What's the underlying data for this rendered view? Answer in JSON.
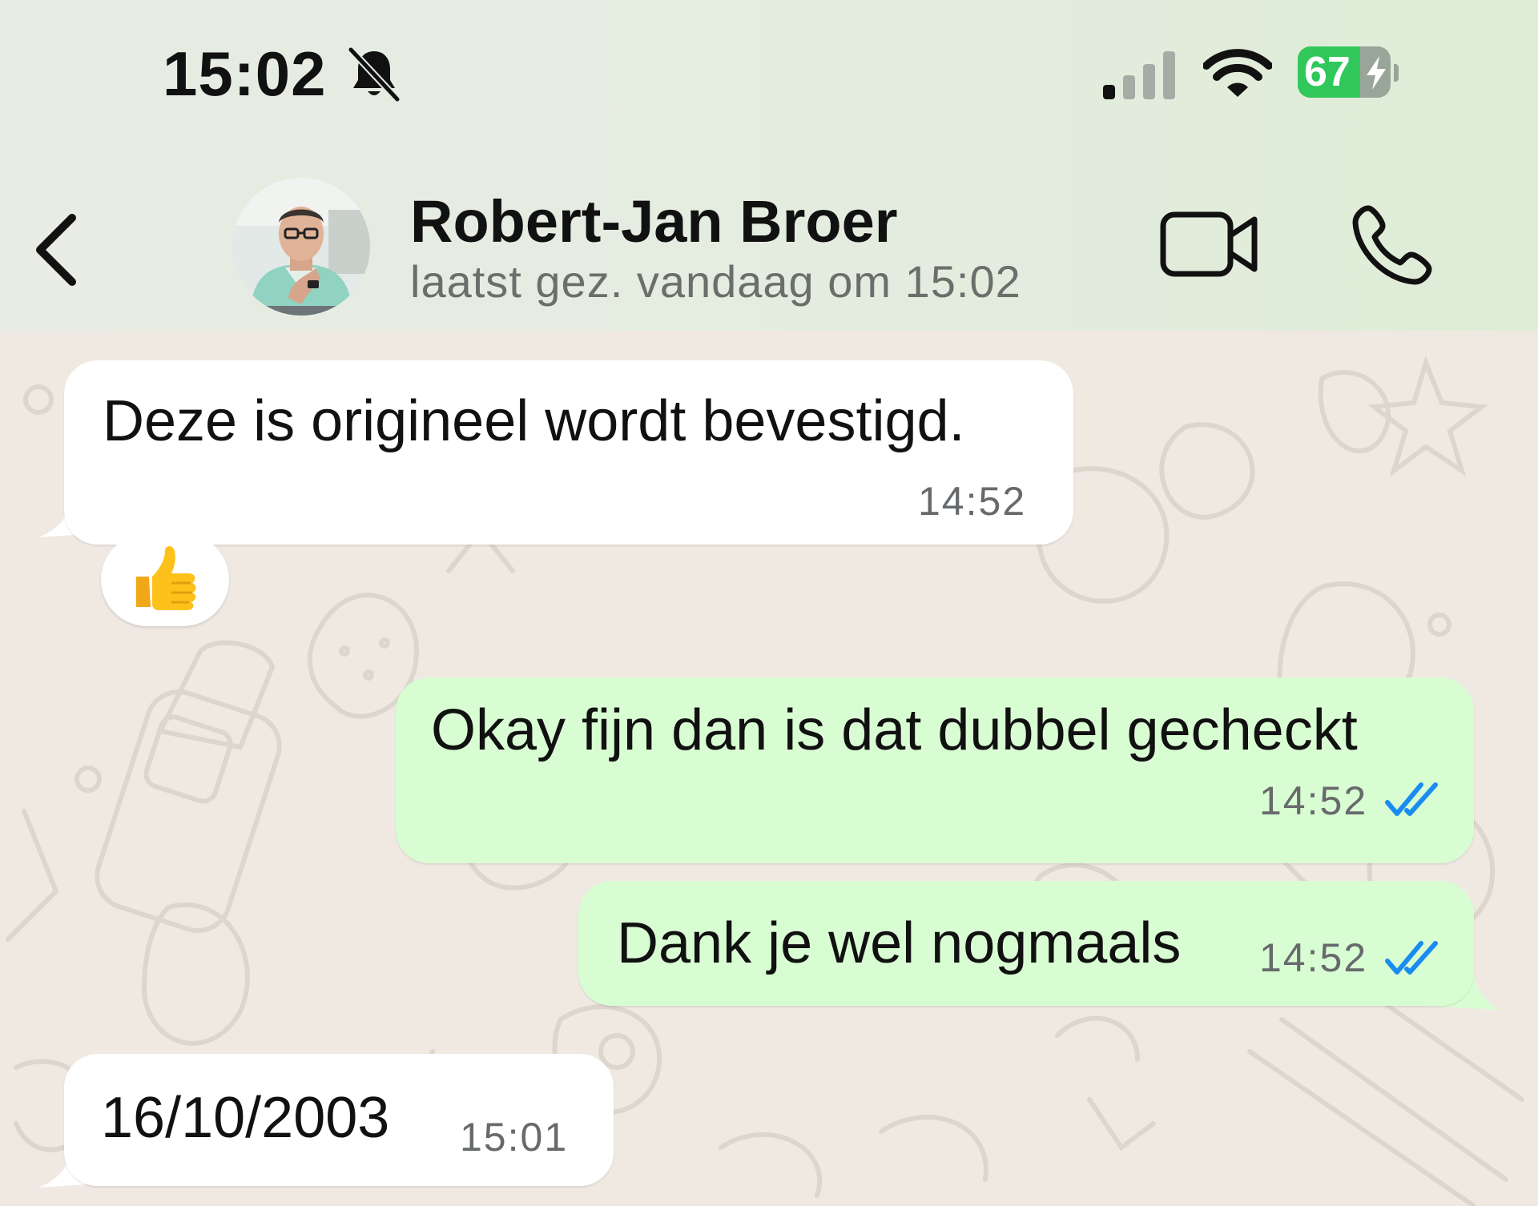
{
  "status_bar": {
    "time": "15:02",
    "battery_level": "67",
    "battery_fraction": 0.67,
    "signal_bars_active": 1,
    "icons": [
      "bell-off-icon",
      "signal-icon",
      "wifi-icon",
      "battery-charging-icon"
    ]
  },
  "header": {
    "contact_name": "Robert-Jan Broer",
    "last_seen": "laatst gez. vandaag om 15:02",
    "icons": [
      "back-chevron-icon",
      "video-call-icon",
      "phone-call-icon"
    ]
  },
  "messages": [
    {
      "direction": "in",
      "text": "Deze is origineel wordt bevestigd.",
      "time": "14:52",
      "reaction": "👍"
    },
    {
      "direction": "out",
      "text": "Okay fijn dan is dat dubbel gecheckt",
      "time": "14:52",
      "status": "read"
    },
    {
      "direction": "out",
      "text": "Dank je wel nogmaals",
      "time": "14:52",
      "status": "read"
    },
    {
      "direction": "in",
      "text": "16/10/2003",
      "time": "15:01"
    }
  ],
  "colors": {
    "outgoing_bubble": "#d9fdd3",
    "incoming_bubble": "#ffffff",
    "read_ticks": "#1a8cf0",
    "battery_green": "#30c85a",
    "chat_background": "#efe9e2"
  }
}
